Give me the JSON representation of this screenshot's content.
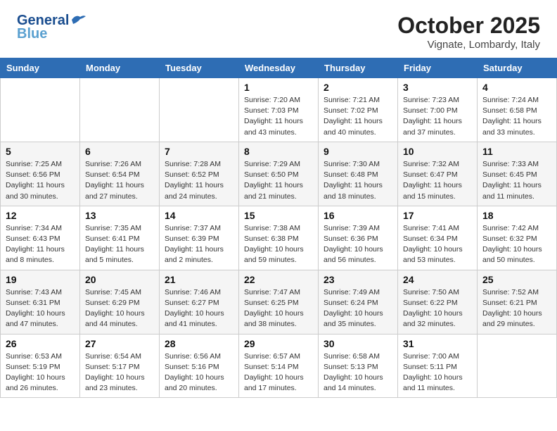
{
  "header": {
    "logo_line1": "General",
    "logo_line2": "Blue",
    "month": "October 2025",
    "location": "Vignate, Lombardy, Italy"
  },
  "days_of_week": [
    "Sunday",
    "Monday",
    "Tuesday",
    "Wednesday",
    "Thursday",
    "Friday",
    "Saturday"
  ],
  "weeks": [
    [
      {
        "day": "",
        "sunrise": "",
        "sunset": "",
        "daylight": ""
      },
      {
        "day": "",
        "sunrise": "",
        "sunset": "",
        "daylight": ""
      },
      {
        "day": "",
        "sunrise": "",
        "sunset": "",
        "daylight": ""
      },
      {
        "day": "1",
        "sunrise": "Sunrise: 7:20 AM",
        "sunset": "Sunset: 7:03 PM",
        "daylight": "Daylight: 11 hours and 43 minutes."
      },
      {
        "day": "2",
        "sunrise": "Sunrise: 7:21 AM",
        "sunset": "Sunset: 7:02 PM",
        "daylight": "Daylight: 11 hours and 40 minutes."
      },
      {
        "day": "3",
        "sunrise": "Sunrise: 7:23 AM",
        "sunset": "Sunset: 7:00 PM",
        "daylight": "Daylight: 11 hours and 37 minutes."
      },
      {
        "day": "4",
        "sunrise": "Sunrise: 7:24 AM",
        "sunset": "Sunset: 6:58 PM",
        "daylight": "Daylight: 11 hours and 33 minutes."
      }
    ],
    [
      {
        "day": "5",
        "sunrise": "Sunrise: 7:25 AM",
        "sunset": "Sunset: 6:56 PM",
        "daylight": "Daylight: 11 hours and 30 minutes."
      },
      {
        "day": "6",
        "sunrise": "Sunrise: 7:26 AM",
        "sunset": "Sunset: 6:54 PM",
        "daylight": "Daylight: 11 hours and 27 minutes."
      },
      {
        "day": "7",
        "sunrise": "Sunrise: 7:28 AM",
        "sunset": "Sunset: 6:52 PM",
        "daylight": "Daylight: 11 hours and 24 minutes."
      },
      {
        "day": "8",
        "sunrise": "Sunrise: 7:29 AM",
        "sunset": "Sunset: 6:50 PM",
        "daylight": "Daylight: 11 hours and 21 minutes."
      },
      {
        "day": "9",
        "sunrise": "Sunrise: 7:30 AM",
        "sunset": "Sunset: 6:48 PM",
        "daylight": "Daylight: 11 hours and 18 minutes."
      },
      {
        "day": "10",
        "sunrise": "Sunrise: 7:32 AM",
        "sunset": "Sunset: 6:47 PM",
        "daylight": "Daylight: 11 hours and 15 minutes."
      },
      {
        "day": "11",
        "sunrise": "Sunrise: 7:33 AM",
        "sunset": "Sunset: 6:45 PM",
        "daylight": "Daylight: 11 hours and 11 minutes."
      }
    ],
    [
      {
        "day": "12",
        "sunrise": "Sunrise: 7:34 AM",
        "sunset": "Sunset: 6:43 PM",
        "daylight": "Daylight: 11 hours and 8 minutes."
      },
      {
        "day": "13",
        "sunrise": "Sunrise: 7:35 AM",
        "sunset": "Sunset: 6:41 PM",
        "daylight": "Daylight: 11 hours and 5 minutes."
      },
      {
        "day": "14",
        "sunrise": "Sunrise: 7:37 AM",
        "sunset": "Sunset: 6:39 PM",
        "daylight": "Daylight: 11 hours and 2 minutes."
      },
      {
        "day": "15",
        "sunrise": "Sunrise: 7:38 AM",
        "sunset": "Sunset: 6:38 PM",
        "daylight": "Daylight: 10 hours and 59 minutes."
      },
      {
        "day": "16",
        "sunrise": "Sunrise: 7:39 AM",
        "sunset": "Sunset: 6:36 PM",
        "daylight": "Daylight: 10 hours and 56 minutes."
      },
      {
        "day": "17",
        "sunrise": "Sunrise: 7:41 AM",
        "sunset": "Sunset: 6:34 PM",
        "daylight": "Daylight: 10 hours and 53 minutes."
      },
      {
        "day": "18",
        "sunrise": "Sunrise: 7:42 AM",
        "sunset": "Sunset: 6:32 PM",
        "daylight": "Daylight: 10 hours and 50 minutes."
      }
    ],
    [
      {
        "day": "19",
        "sunrise": "Sunrise: 7:43 AM",
        "sunset": "Sunset: 6:31 PM",
        "daylight": "Daylight: 10 hours and 47 minutes."
      },
      {
        "day": "20",
        "sunrise": "Sunrise: 7:45 AM",
        "sunset": "Sunset: 6:29 PM",
        "daylight": "Daylight: 10 hours and 44 minutes."
      },
      {
        "day": "21",
        "sunrise": "Sunrise: 7:46 AM",
        "sunset": "Sunset: 6:27 PM",
        "daylight": "Daylight: 10 hours and 41 minutes."
      },
      {
        "day": "22",
        "sunrise": "Sunrise: 7:47 AM",
        "sunset": "Sunset: 6:25 PM",
        "daylight": "Daylight: 10 hours and 38 minutes."
      },
      {
        "day": "23",
        "sunrise": "Sunrise: 7:49 AM",
        "sunset": "Sunset: 6:24 PM",
        "daylight": "Daylight: 10 hours and 35 minutes."
      },
      {
        "day": "24",
        "sunrise": "Sunrise: 7:50 AM",
        "sunset": "Sunset: 6:22 PM",
        "daylight": "Daylight: 10 hours and 32 minutes."
      },
      {
        "day": "25",
        "sunrise": "Sunrise: 7:52 AM",
        "sunset": "Sunset: 6:21 PM",
        "daylight": "Daylight: 10 hours and 29 minutes."
      }
    ],
    [
      {
        "day": "26",
        "sunrise": "Sunrise: 6:53 AM",
        "sunset": "Sunset: 5:19 PM",
        "daylight": "Daylight: 10 hours and 26 minutes."
      },
      {
        "day": "27",
        "sunrise": "Sunrise: 6:54 AM",
        "sunset": "Sunset: 5:17 PM",
        "daylight": "Daylight: 10 hours and 23 minutes."
      },
      {
        "day": "28",
        "sunrise": "Sunrise: 6:56 AM",
        "sunset": "Sunset: 5:16 PM",
        "daylight": "Daylight: 10 hours and 20 minutes."
      },
      {
        "day": "29",
        "sunrise": "Sunrise: 6:57 AM",
        "sunset": "Sunset: 5:14 PM",
        "daylight": "Daylight: 10 hours and 17 minutes."
      },
      {
        "day": "30",
        "sunrise": "Sunrise: 6:58 AM",
        "sunset": "Sunset: 5:13 PM",
        "daylight": "Daylight: 10 hours and 14 minutes."
      },
      {
        "day": "31",
        "sunrise": "Sunrise: 7:00 AM",
        "sunset": "Sunset: 5:11 PM",
        "daylight": "Daylight: 10 hours and 11 minutes."
      },
      {
        "day": "",
        "sunrise": "",
        "sunset": "",
        "daylight": ""
      }
    ]
  ]
}
